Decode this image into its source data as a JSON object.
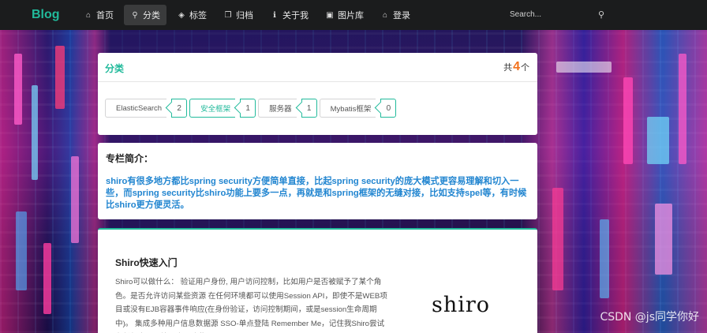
{
  "nav": {
    "brand": "Blog",
    "items": [
      {
        "label": "首页",
        "icon": "home-icon"
      },
      {
        "label": "分类",
        "icon": "map-pin-icon",
        "active": true
      },
      {
        "label": "标签",
        "icon": "tags-icon"
      },
      {
        "label": "归档",
        "icon": "clone-icon"
      },
      {
        "label": "关于我",
        "icon": "info-icon"
      },
      {
        "label": "图片库",
        "icon": "image-icon"
      },
      {
        "label": "登录",
        "icon": "home-icon"
      }
    ],
    "search_placeholder": "Search..."
  },
  "category": {
    "title": "分类",
    "count_prefix": "共",
    "count": "4",
    "count_suffix": "个",
    "tags": [
      {
        "label": "ElasticSearch",
        "count": "2"
      },
      {
        "label": "安全框架",
        "count": "1",
        "active": true
      },
      {
        "label": "服务器",
        "count": "1"
      },
      {
        "label": "Mybatis框架",
        "count": "0"
      }
    ]
  },
  "intro": {
    "heading": "专栏简介：",
    "description": "shiro有很多地方都比spring security方便简单直接，比起spring security的庞大模式更容易理解和切入一些，而spring security比shiro功能上要多一点，再就是和spring框架的无缝对接，比如支持spel等，有时候比shiro更方便灵活。"
  },
  "article": {
    "title": "Shiro快速入门",
    "body": "Shiro可以做什么： 验证用户身份, 用户访问控制，比如用户是否被赋予了某个角色。是否允许访问某些资源 在任何环境都可以使用Session API，即使不是WEB项目或没有EJB容器事件响应(在身份验证，访问控制期间，或是session生命周期中)。 集成多种用户信息数据源 SSO-单点登陆 Remember Me，记住我Shiro尝试在任何应用环境下实现这些",
    "thumbnail_text": "shiro"
  },
  "watermark": "CSDN @js同学你好",
  "colors": {
    "accent": "#21ba9b",
    "link": "#2185d0",
    "count": "#f2711c",
    "navbar": "#1b1c1d"
  }
}
